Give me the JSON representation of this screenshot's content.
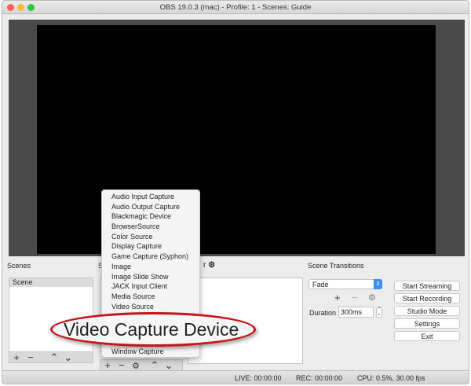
{
  "window": {
    "title": "OBS 19.0.3 (mac) - Profile: 1 - Scenes: Guide"
  },
  "scenes": {
    "label": "Scenes",
    "items": [
      "Scene"
    ]
  },
  "sources": {
    "label_partial": "S"
  },
  "mixer": {
    "label_partial": "r"
  },
  "source_menu": {
    "items": [
      "Audio Input Capture",
      "Audio Output Capture",
      "Blackmagic Device",
      "BrowserSource",
      "Color Source",
      "Display Capture",
      "Game Capture (Syphon)",
      "Image",
      "Image Slide Show",
      "JACK Input Client",
      "Media Source",
      "Video Source",
      "Video Capture Device",
      "Window Capture"
    ],
    "highlighted": "Video Capture Device"
  },
  "transitions": {
    "label": "Scene Transitions",
    "selected": "Fade",
    "duration_label": "Duration",
    "duration_value": "300ms"
  },
  "controls": {
    "start_streaming": "Start Streaming",
    "start_recording": "Start Recording",
    "studio_mode": "Studio Mode",
    "settings": "Settings",
    "exit": "Exit"
  },
  "status": {
    "live": "LIVE: 00:00:00",
    "rec": "REC: 00:00:00",
    "cpu": "CPU: 0.5%, 30.00 fps"
  },
  "colors": {
    "highlight_ring": "#c8151b",
    "select_accent": "#3b8ef5"
  }
}
